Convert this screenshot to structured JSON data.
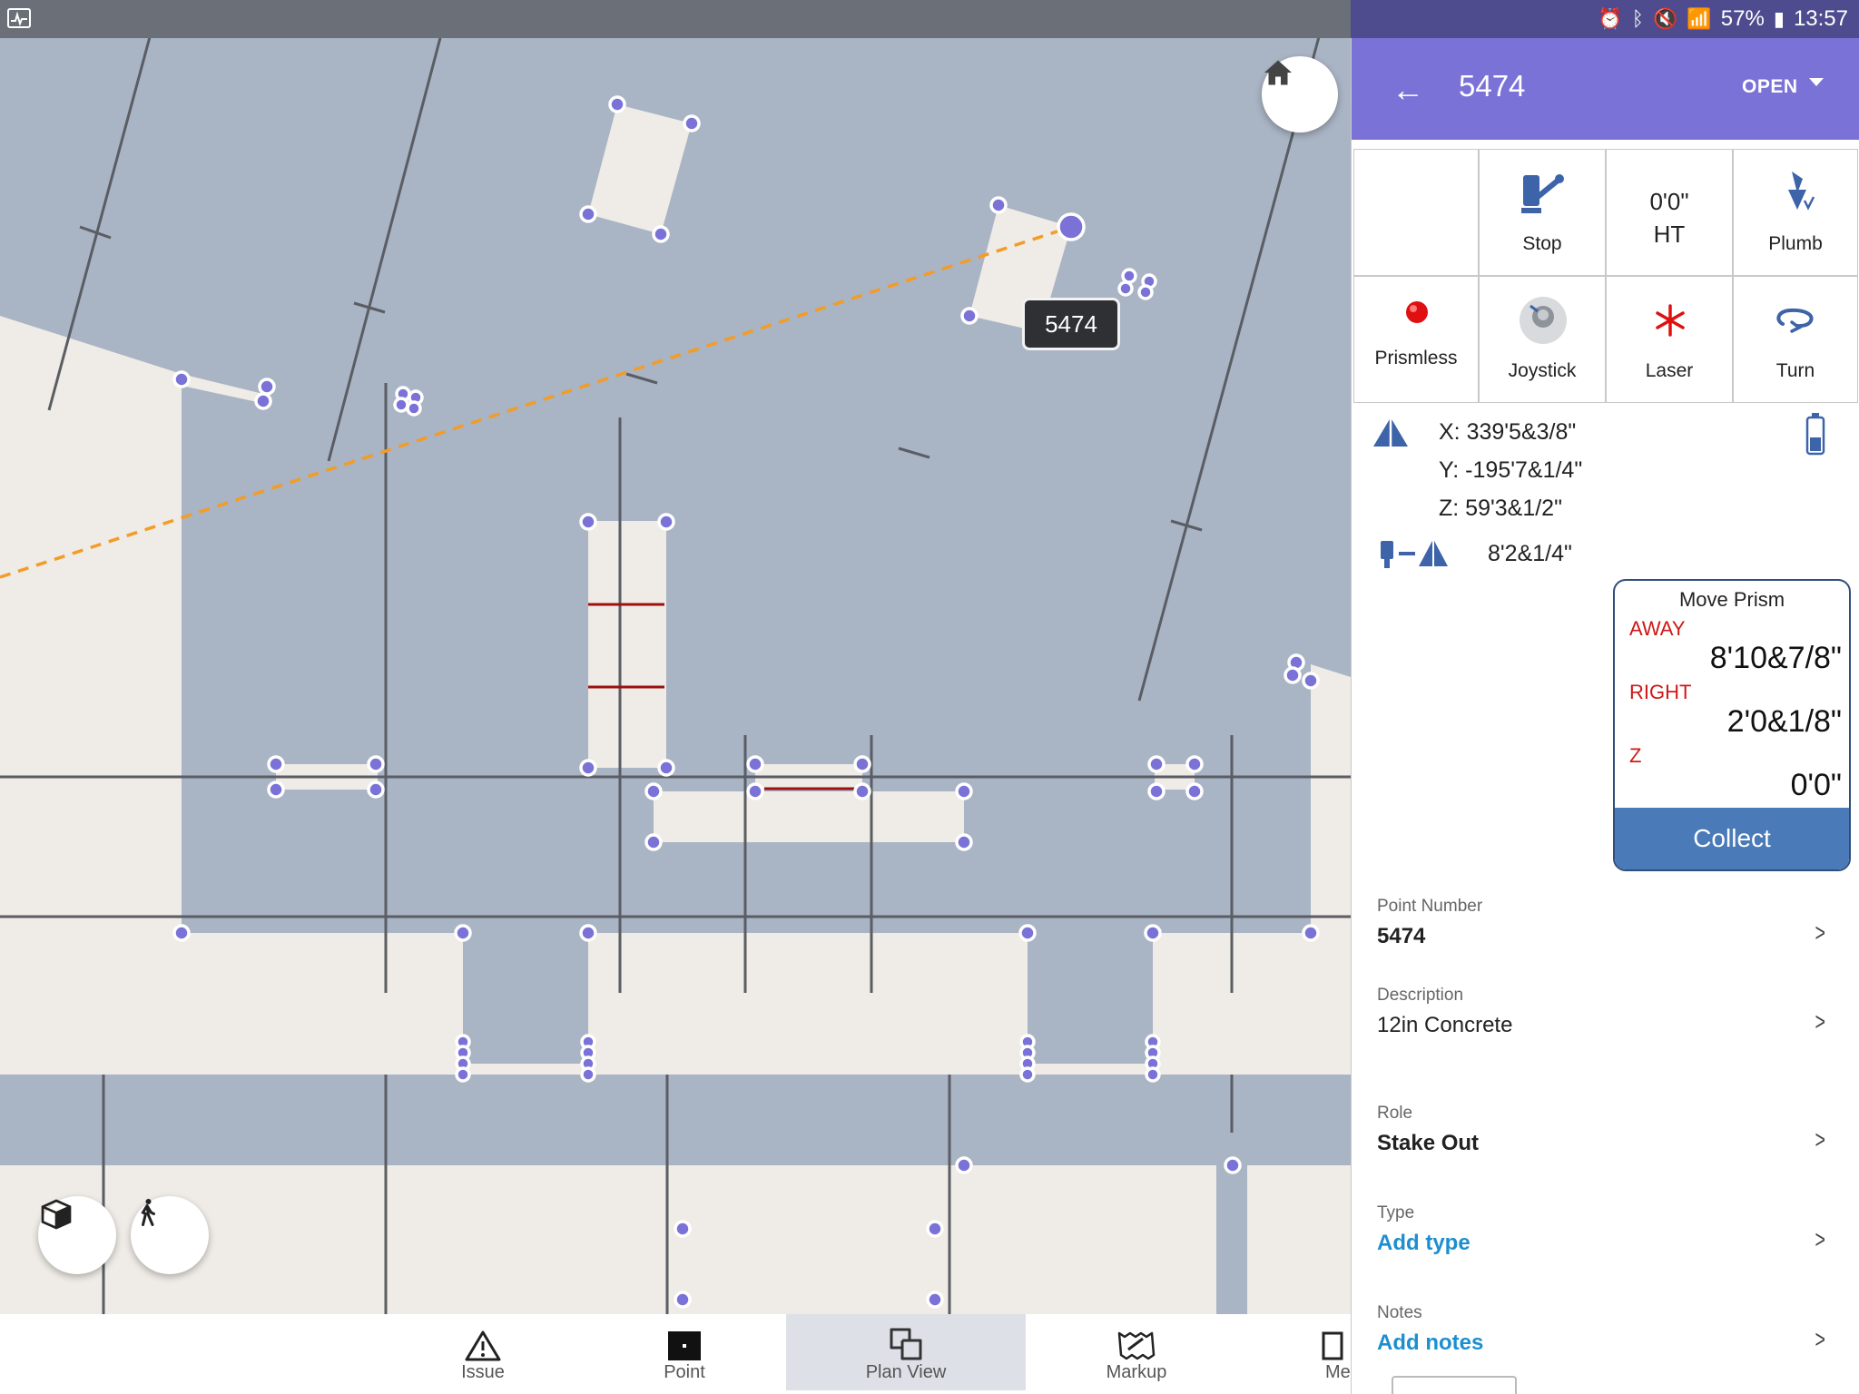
{
  "status_bar": {
    "battery": "57%",
    "time": "13:57"
  },
  "map": {
    "selected_point_label": "5474"
  },
  "panel": {
    "header": {
      "title": "5474",
      "status": "OPEN"
    },
    "controls": [
      {
        "label": "",
        "icon": "blank"
      },
      {
        "label": "Stop",
        "icon": "instrument-icon"
      },
      {
        "label": "HT",
        "value": "0'0\"",
        "icon": "height-text"
      },
      {
        "label": "Plumb",
        "icon": "plumb-icon"
      },
      {
        "label": "Prismless",
        "icon": "red-dot-icon"
      },
      {
        "label": "Joystick",
        "icon": "joystick-icon"
      },
      {
        "label": "Laser",
        "icon": "laser-icon"
      },
      {
        "label": "Turn",
        "icon": "turn-icon"
      }
    ],
    "coordinates": {
      "x": "X: 339'5&3/8\"",
      "y": "Y: -195'7&1/4\"",
      "z": "Z: 59'3&1/2\"",
      "distance": "8'2&1/4\""
    },
    "move_prism": {
      "title": "Move Prism",
      "rows": [
        {
          "direction": "AWAY",
          "value": "8'10&7/8\""
        },
        {
          "direction": "RIGHT",
          "value": "2'0&1/8\""
        },
        {
          "direction": "Z",
          "value": "0'0\""
        }
      ],
      "collect_label": "Collect"
    },
    "properties": [
      {
        "label": "Point Number",
        "value": "5474",
        "style": "bold"
      },
      {
        "label": "Description",
        "value": "12in Concrete",
        "style": "normal"
      },
      {
        "label": "Role",
        "value": "Stake Out",
        "style": "bold"
      },
      {
        "label": "Type",
        "value": "Add type",
        "style": "link"
      },
      {
        "label": "Notes",
        "value": "Add notes",
        "style": "link"
      }
    ]
  },
  "bottom_nav": [
    {
      "label": "Issue",
      "icon": "warning-icon"
    },
    {
      "label": "Point",
      "icon": "point-icon"
    },
    {
      "label": "Plan View",
      "icon": "plan-view-icon",
      "active": true
    },
    {
      "label": "Markup",
      "icon": "markup-icon"
    },
    {
      "label": "Me",
      "icon": "more-icon"
    }
  ],
  "colors": {
    "map_background": "#a9b4c4",
    "slab": "#efebe6",
    "vertex": "#7b72d8",
    "header": "#7b72d8",
    "collect": "#4a7ab8",
    "direction_text": "#d01717",
    "link": "#1d8fcf",
    "guide_line": "#f39c26"
  }
}
